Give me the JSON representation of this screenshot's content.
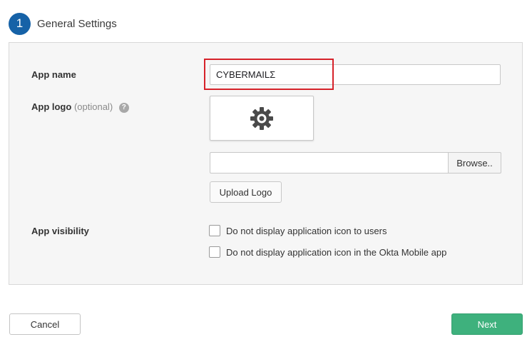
{
  "step": {
    "number": "1",
    "title": "General Settings"
  },
  "form": {
    "app_name": {
      "label": "App name",
      "value": "CYBERMAILΣ"
    },
    "app_logo": {
      "label": "App logo",
      "optional": "(optional)",
      "help_icon": "?",
      "logo_icon": "gear-icon",
      "file_value": "",
      "browse_label": "Browse..",
      "upload_label": "Upload Logo"
    },
    "app_visibility": {
      "label": "App visibility",
      "options": [
        {
          "label": "Do not display application icon to users",
          "checked": false
        },
        {
          "label": "Do not display application icon in the Okta Mobile app",
          "checked": false
        }
      ]
    }
  },
  "footer": {
    "cancel_label": "Cancel",
    "next_label": "Next"
  },
  "colors": {
    "step_circle": "#1662a7",
    "highlight": "#d6222a",
    "next_button": "#3eb17d",
    "panel_bg": "#f6f6f6"
  }
}
